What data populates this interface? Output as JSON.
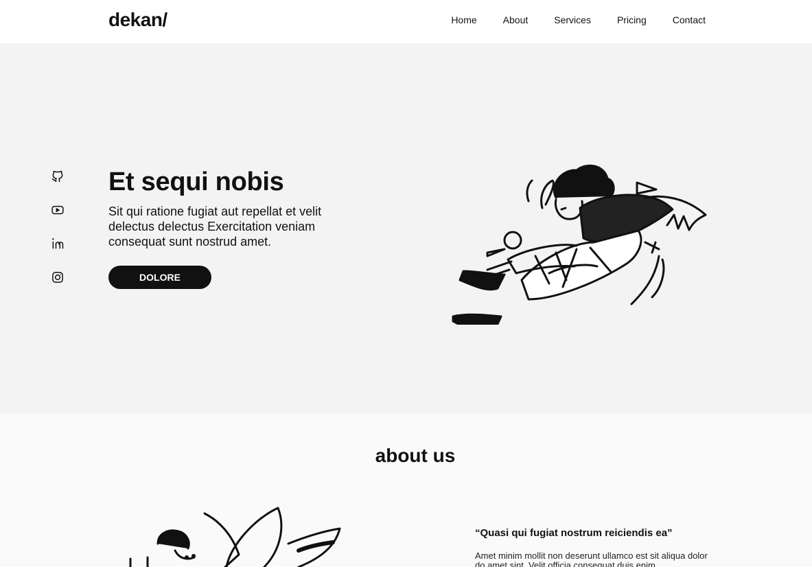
{
  "nav": {
    "logo": "dekan/",
    "links": [
      "Home",
      "About",
      "Services",
      "Pricing",
      "Contact"
    ]
  },
  "hero": {
    "title": "Et sequi nobis",
    "description": "Sit qui ratione fugiat aut repellat et velit delectus delectus Exercitation veniam consequat sunt nostrud amet.",
    "cta": "DOLORE",
    "social_icons": [
      "github-icon",
      "youtube-icon",
      "linkedin-icon",
      "instagram-icon"
    ]
  },
  "about": {
    "title": "about us",
    "quote": "“Quasi qui fugiat nostrum reiciendis ea”",
    "text": "Amet minim mollit non deserunt ullamco est sit aliqua dolor do amet sint. Velit officia consequat duis enim"
  },
  "colors": {
    "accent": "#111111",
    "hero_bg": "#f3f3f3",
    "about_bg": "#fafafa"
  }
}
